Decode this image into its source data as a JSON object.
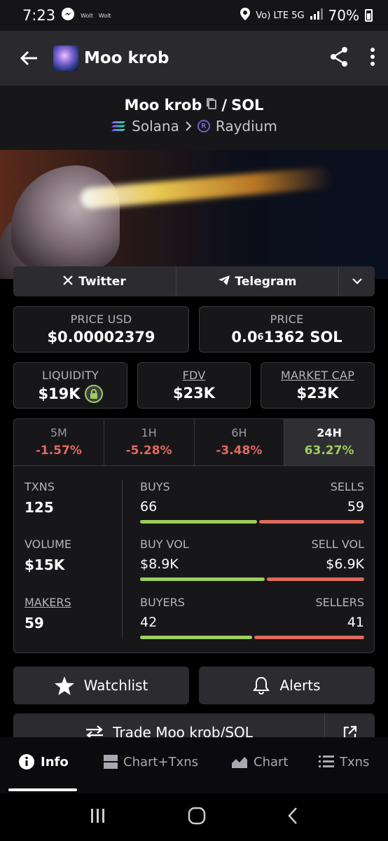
{
  "status_bar": {
    "time": "7:23",
    "notif_1": "Wolt",
    "notif_2": "Wolt",
    "network": "Vo) LTE 5G",
    "battery": "70%"
  },
  "header": {
    "title": "Moo krob"
  },
  "pair": {
    "base": "Moo krob",
    "separator": "/",
    "quote": "SOL",
    "chain": "Solana",
    "dex": "Raydium"
  },
  "links": {
    "twitter": "Twitter",
    "telegram": "Telegram"
  },
  "price_usd": {
    "label": "PRICE USD",
    "value": "$0.00002379"
  },
  "price_native": {
    "label": "PRICE",
    "prefix": "0.0",
    "zeros": "6",
    "rest": "1362 SOL"
  },
  "liquidity": {
    "label": "LIQUIDITY",
    "value": "$19K"
  },
  "fdv": {
    "label": "FDV",
    "value": "$23K"
  },
  "market_cap": {
    "label": "MARKET CAP",
    "value": "$23K"
  },
  "timeframes": [
    {
      "label": "5M",
      "change": "-1.57%"
    },
    {
      "label": "1H",
      "change": "-5.28%"
    },
    {
      "label": "6H",
      "change": "-3.48%"
    },
    {
      "label": "24H",
      "change": "63.27%"
    }
  ],
  "stats": {
    "txns": {
      "label": "TXNS",
      "value": "125",
      "left_label": "BUYS",
      "right_label": "SELLS",
      "left_value": "66",
      "right_value": "59",
      "left_fraction": 0.528
    },
    "volume": {
      "label": "VOLUME",
      "value": "$15K",
      "left_label": "BUY VOL",
      "right_label": "SELL VOL",
      "left_value": "$8.9K",
      "right_value": "$6.9K",
      "left_fraction": 0.563
    },
    "makers": {
      "label": "MAKERS",
      "value": "59",
      "left_label": "BUYERS",
      "right_label": "SELLERS",
      "left_value": "42",
      "right_value": "41",
      "left_fraction": 0.506
    }
  },
  "actions": {
    "watchlist": "Watchlist",
    "alerts": "Alerts",
    "trade": "Trade Moo krob/SOL"
  },
  "bottom_nav": {
    "info": "Info",
    "chart_txns": "Chart+Txns",
    "chart": "Chart",
    "txns": "Txns"
  },
  "colors": {
    "positive": "#9ccf5d",
    "negative": "#e06a5e",
    "surface": "#2c2c30",
    "background": "#17171a"
  }
}
